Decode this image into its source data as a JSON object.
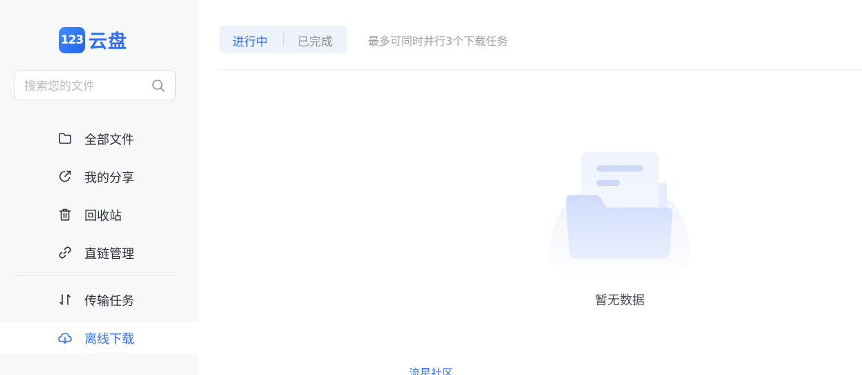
{
  "logo": {
    "badge": "123",
    "text": "云盘"
  },
  "search": {
    "placeholder": "搜索您的文件"
  },
  "sidebar": {
    "items": [
      {
        "label": "全部文件",
        "icon": "folder-icon"
      },
      {
        "label": "我的分享",
        "icon": "share-icon"
      },
      {
        "label": "回收站",
        "icon": "trash-icon"
      },
      {
        "label": "直链管理",
        "icon": "link-icon"
      },
      {
        "label": "传输任务",
        "icon": "transfer-icon"
      },
      {
        "label": "离线下载",
        "icon": "cloud-download-icon",
        "active": true
      }
    ]
  },
  "tabs": {
    "ongoing": "进行中",
    "done": "已完成"
  },
  "hint": "最多可同时并行3个下载任务",
  "empty": {
    "text": "暂无数据"
  },
  "footer": {
    "link": "流星社区"
  },
  "colors": {
    "accent": "#2f6ef5",
    "sidebar_bg": "#f7f8fa"
  }
}
